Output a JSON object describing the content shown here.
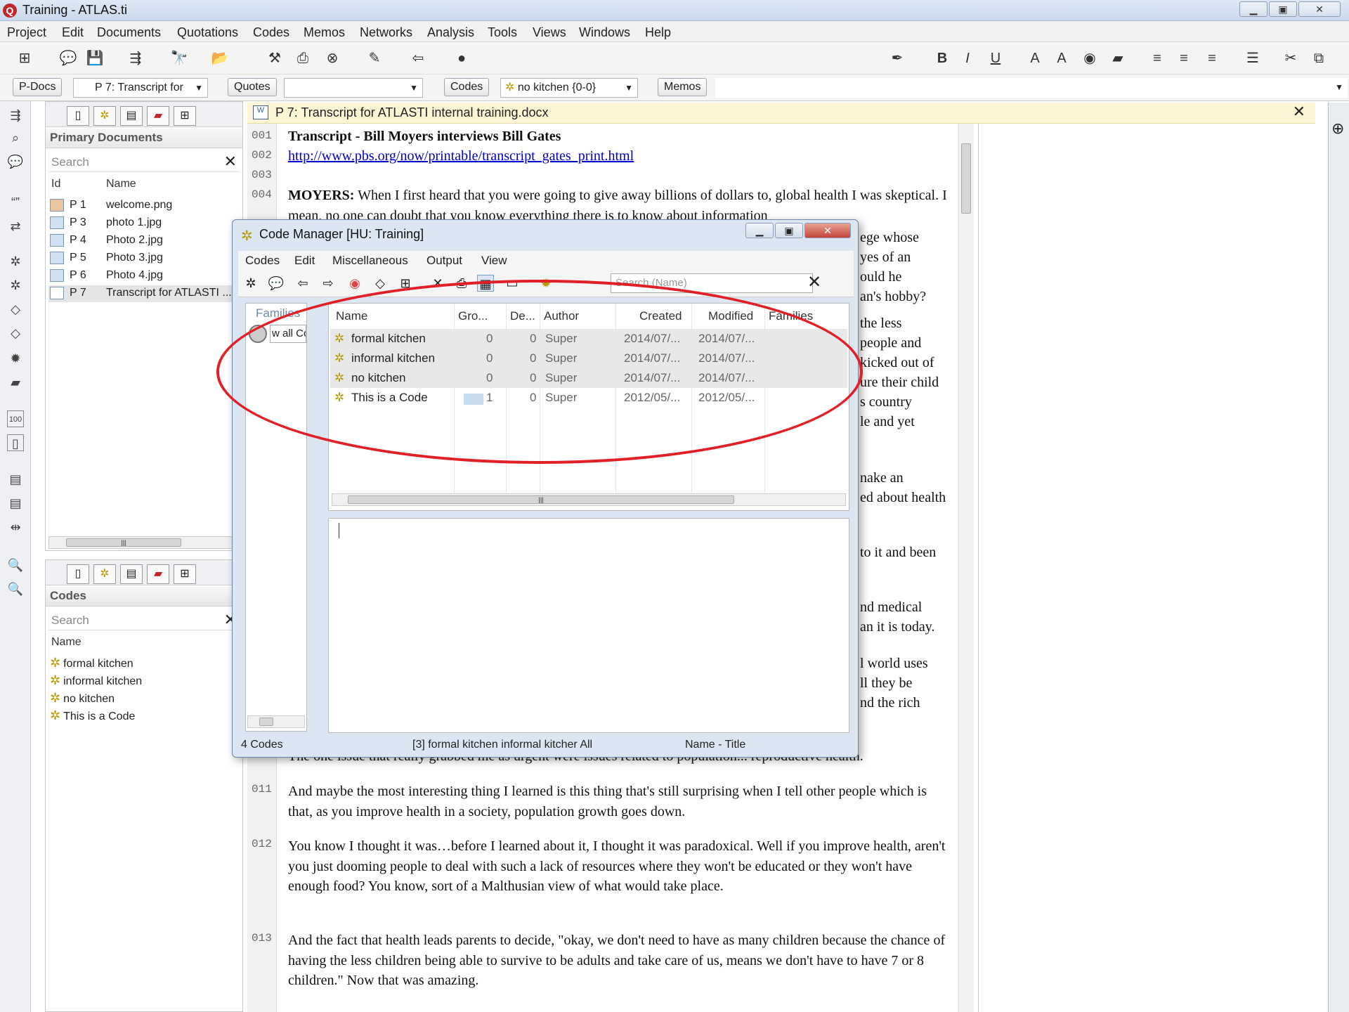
{
  "window": {
    "title": "Training - ATLAS.ti",
    "logo": "Q"
  },
  "menubar": [
    "Project",
    "Edit",
    "Documents",
    "Quotations",
    "Codes",
    "Memos",
    "Networks",
    "Analysis",
    "Tools",
    "Views",
    "Windows",
    "Help"
  ],
  "toolbar2": {
    "pdocs_btn": "P-Docs",
    "pdocs_combo": "P 7: Transcript for",
    "quotes_btn": "Quotes",
    "codes_btn": "Codes",
    "codes_combo": "no kitchen {0-0}",
    "memos_btn": "Memos"
  },
  "pdoc_manager": {
    "heading": "Primary Documents",
    "search_placeholder": "Search",
    "col_id": "Id",
    "col_name": "Name",
    "rows": [
      {
        "id": "P 1",
        "name": "welcome.png"
      },
      {
        "id": "P 3",
        "name": "photo 1.jpg"
      },
      {
        "id": "P 4",
        "name": "Photo 2.jpg"
      },
      {
        "id": "P 5",
        "name": "Photo 3.jpg"
      },
      {
        "id": "P 6",
        "name": "Photo 4.jpg"
      },
      {
        "id": "P 7",
        "name": "Transcript for ATLASTI ..."
      }
    ]
  },
  "code_panel": {
    "heading": "Codes",
    "search_placeholder": "Search",
    "col_name": "Name",
    "rows": [
      "formal kitchen",
      "informal kitchen",
      "no kitchen",
      "This is a Code"
    ]
  },
  "document": {
    "tab_title": "P 7: Transcript for ATLASTI internal training.docx",
    "line_numbers": [
      "001",
      "002",
      "003",
      "004",
      "011",
      "012",
      "013"
    ],
    "title": "Transcript - Bill Moyers interviews Bill Gates",
    "link": "http://www.pbs.org/now/printable/transcript_gates_print.html",
    "p004_speaker": "MOYERS:",
    "p004_text": " When I first heard that you were going to give away billions of dollars to, global health I was skeptical. I mean, no one can doubt that you know everything there is to know about information",
    "fragments": [
      "ege whose",
      "yes of an",
      "ould he",
      "an's hobby?",
      "the less",
      "people and",
      "kicked out of",
      "ure their child",
      "s country",
      "le and yet",
      "nake an",
      "ed about health",
      "to it and been",
      "nd medical",
      "an it is today.",
      "l world uses",
      "ll they be",
      "nd the rich"
    ],
    "p010_tail": "The one issue that really grabbed me as urgent were issues related to population... reproductive health.",
    "p011": "And maybe the most interesting thing I learned is this thing that's still surprising when I tell other people which is that, as you improve health in a society, population growth goes down.",
    "p012": "You know I thought it was…before I learned about it, I thought it was paradoxical. Well if you improve health, aren't you just dooming people to deal with such a lack of resources where they won't be educated or they won't have enough food? You know, sort of a Malthusian view of what would take place.",
    "p013": "And the fact that health leads parents to decide, \"okay, we don't need to have as many children because the chance of having the less children being able to survive to be adults and take care of us, means we don't have to have 7 or 8 children.\" Now that was amazing."
  },
  "code_manager": {
    "title": "Code Manager [HU: Training]",
    "menu": [
      "Codes",
      "Edit",
      "Miscellaneous",
      "Output",
      "View"
    ],
    "search_placeholder": "Search (Name)",
    "families_label": "Families",
    "show_all": "w all Cc",
    "columns": [
      "Name",
      "Gro...",
      "De...",
      "Author",
      "Created",
      "Modified",
      "Families"
    ],
    "rows": [
      {
        "name": "formal kitchen",
        "gro": "0",
        "de": "0",
        "author": "Super",
        "created": "2014/07/...",
        "modified": "2014/07/..."
      },
      {
        "name": "informal kitchen",
        "gro": "0",
        "de": "0",
        "author": "Super",
        "created": "2014/07/...",
        "modified": "2014/07/..."
      },
      {
        "name": "no kitchen",
        "gro": "0",
        "de": "0",
        "author": "Super",
        "created": "2014/07/...",
        "modified": "2014/07/..."
      },
      {
        "name": "This is a Code",
        "gro": "1",
        "de": "0",
        "author": "Super",
        "created": "2012/05/...",
        "modified": "2012/05/..."
      }
    ],
    "status_count": "4 Codes",
    "status_selection": "[3] formal kitchen  informal kitcher  All",
    "status_sort": "Name - Title"
  },
  "colors": {
    "annotation": "#e01f26",
    "doc_tab_bg": "#fdf5d4",
    "code_icon": "#b69a00",
    "link": "#0000cc"
  }
}
